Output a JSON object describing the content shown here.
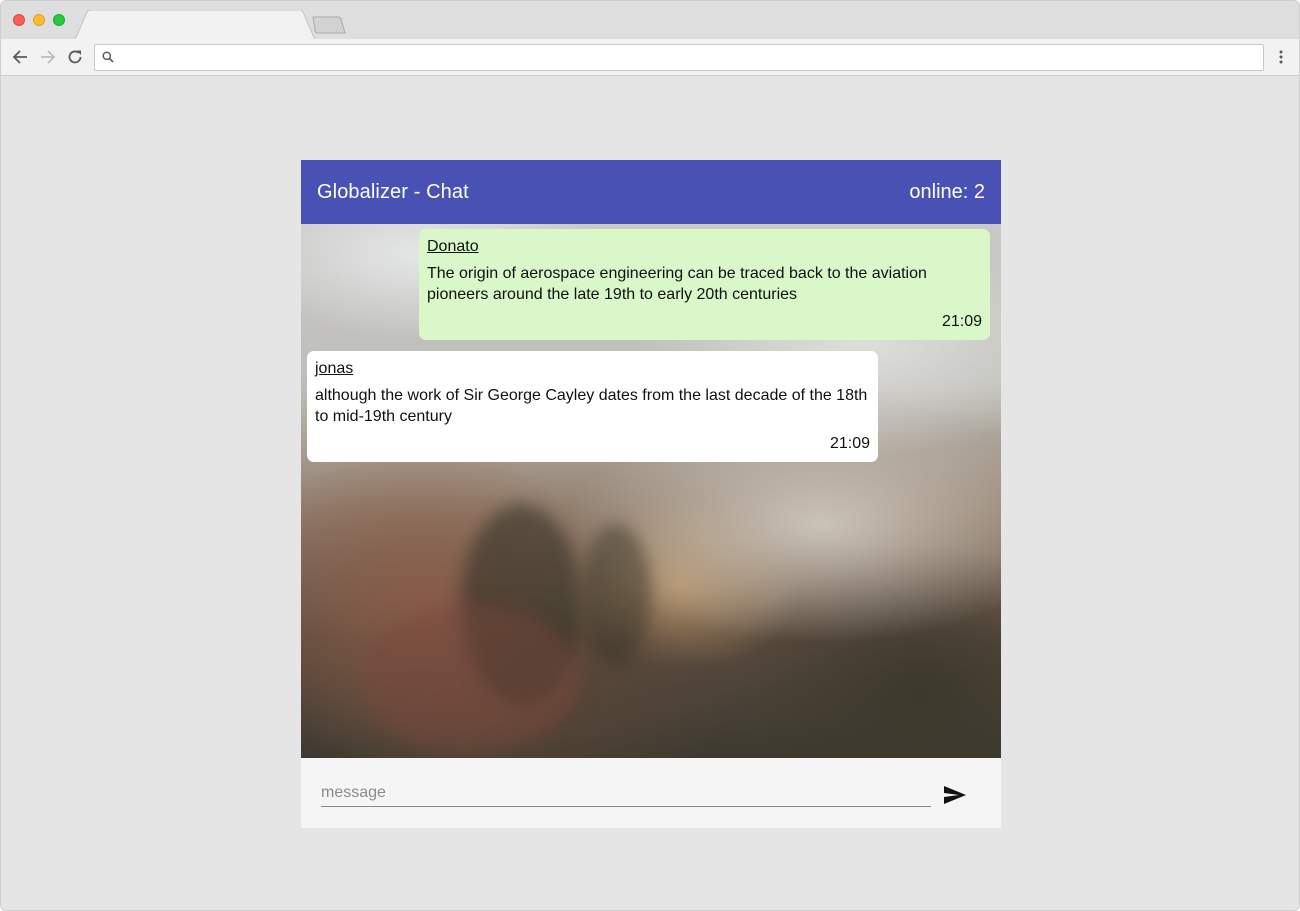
{
  "browser": {
    "address_bar": {
      "value": "",
      "placeholder": ""
    },
    "icons": {
      "back": "arrow-left-icon",
      "forward": "arrow-right-icon",
      "reload": "reload-icon",
      "search": "search-icon",
      "menu": "kebab-menu-icon"
    }
  },
  "chat": {
    "title": "Globalizer - Chat",
    "online_label": "online:",
    "online_count": "2",
    "header_color": "#4a51b5",
    "messages": [
      {
        "author": "Donato",
        "text": "The origin of aerospace engineering can be traced back to the aviation pioneers around the late 19th to early 20th centuries",
        "time": "21:09",
        "own": true,
        "bubble_color": "#d9f7c8"
      },
      {
        "author": "jonas",
        "text": "although the work of Sir George Cayley dates from the last decade of the 18th to mid-19th century",
        "time": "21:09",
        "own": false,
        "bubble_color": "#ffffff"
      }
    ],
    "composer": {
      "placeholder": "message",
      "value": "",
      "send_icon": "send-icon"
    }
  }
}
